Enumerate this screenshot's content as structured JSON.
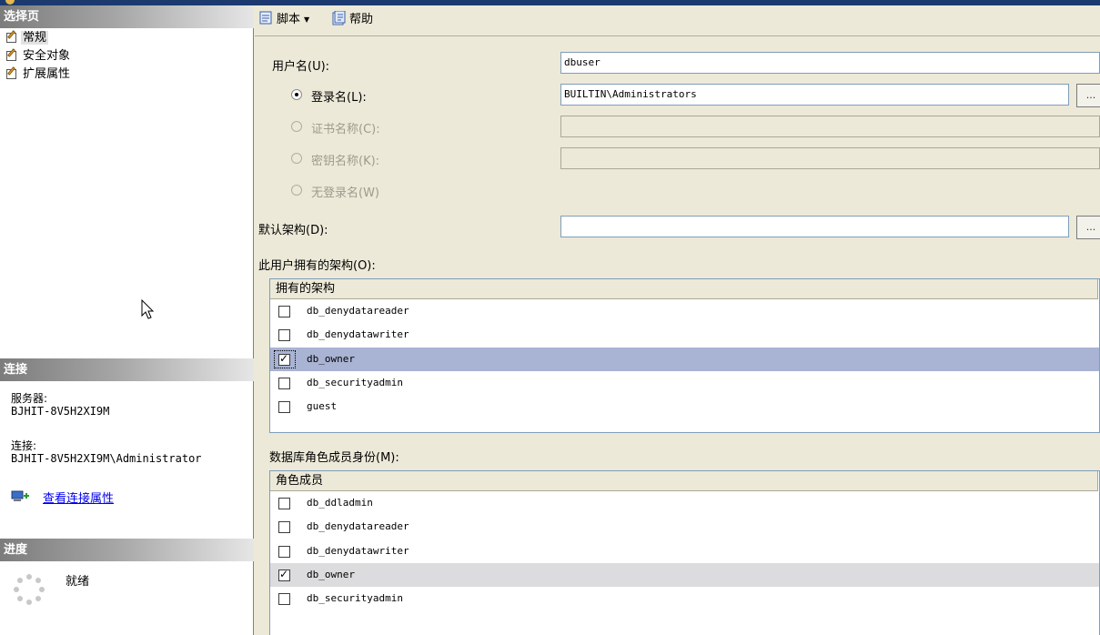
{
  "left_pane": {
    "select_page_header": "选择页",
    "nav_items": [
      {
        "label": "常规",
        "icon": "page-settings-icon"
      },
      {
        "label": "安全对象",
        "icon": "page-settings-icon"
      },
      {
        "label": "扩展属性",
        "icon": "page-settings-icon"
      }
    ],
    "connection_header": "连接",
    "server_label": "服务器:",
    "server_value": "BJHIT-8V5H2XI9M",
    "connection_label": "连接:",
    "connection_value": "BJHIT-8V5H2XI9M\\Administrator",
    "view_connection_link": "查看连接属性",
    "progress_header": "进度",
    "progress_status": "就绪"
  },
  "toolbar": {
    "script_label": "脚本",
    "help_label": "帮助"
  },
  "form": {
    "user_name_label": "用户名(U):",
    "user_name_value": "dbuser",
    "login_name_label": "登录名(L):",
    "login_name_value": "BUILTIN\\Administrators",
    "cert_name_label": "证书名称(C):",
    "key_name_label": "密钥名称(K):",
    "no_login_label": "无登录名(W)",
    "default_schema_label": "默认架构(D):",
    "default_schema_value": "",
    "browse_label": "...",
    "owned_schemas_label": "此用户拥有的架构(O):",
    "role_membership_label": "数据库角色成员身份(M):"
  },
  "owned_schemas": {
    "column_header": "拥有的架构",
    "rows": [
      {
        "name": "db_denydatareader",
        "checked": false
      },
      {
        "name": "db_denydatawriter",
        "checked": false
      },
      {
        "name": "db_owner",
        "checked": true
      },
      {
        "name": "db_securityadmin",
        "checked": false
      },
      {
        "name": "guest",
        "checked": false
      }
    ]
  },
  "role_members": {
    "column_header": "角色成员",
    "rows": [
      {
        "name": "db_ddladmin",
        "checked": false
      },
      {
        "name": "db_denydatareader",
        "checked": false
      },
      {
        "name": "db_denydatawriter",
        "checked": false
      },
      {
        "name": "db_owner",
        "checked": true
      },
      {
        "name": "db_securityadmin",
        "checked": false
      }
    ]
  },
  "check_mark": "✓"
}
